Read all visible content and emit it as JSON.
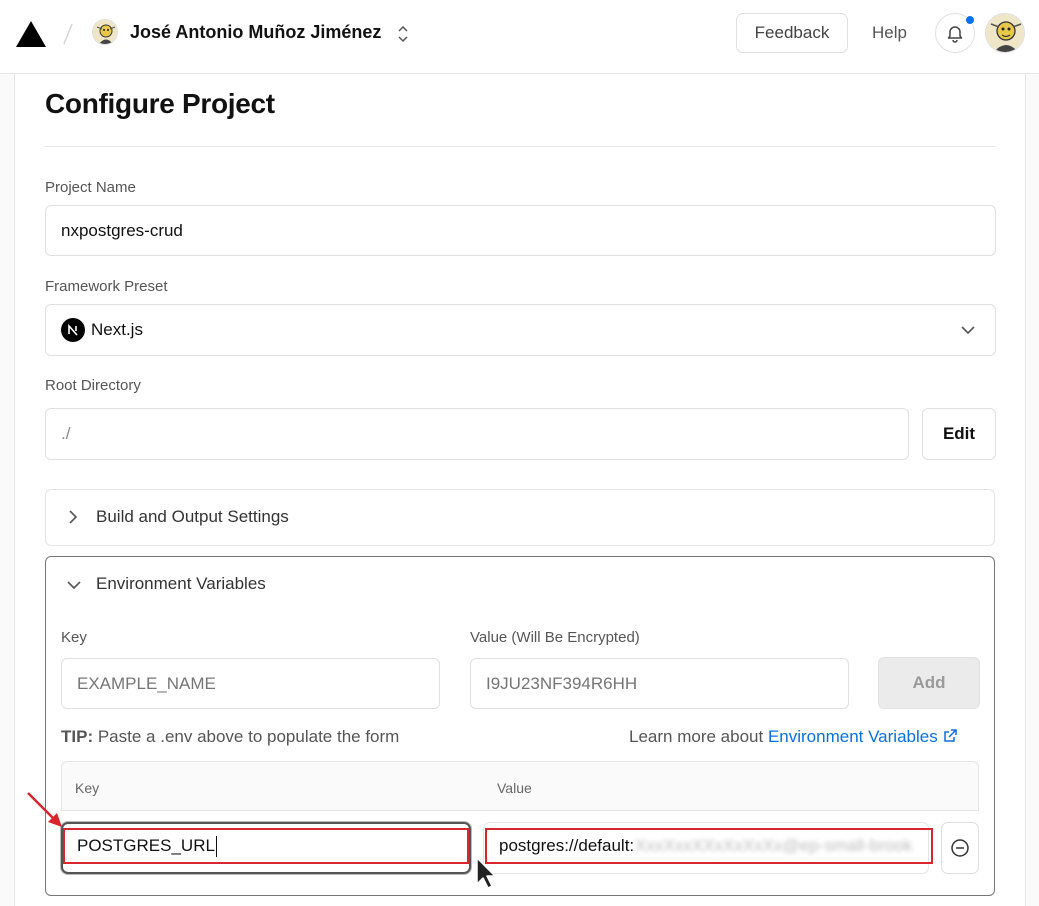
{
  "header": {
    "team_name": "José Antonio Muñoz Jiménez",
    "feedback_label": "Feedback",
    "help_label": "Help",
    "notification_dot_color": "#0a72ef",
    "icons": [
      "logo-triangle-icon",
      "slash-separator-icon",
      "chevron-up-down-icon",
      "bell-icon"
    ]
  },
  "page": {
    "title": "Configure Project"
  },
  "project_name": {
    "label": "Project Name",
    "value": "nxpostgres-crud"
  },
  "framework": {
    "label": "Framework Preset",
    "value": "Next.js",
    "icon": "nextjs-icon"
  },
  "root_directory": {
    "label": "Root Directory",
    "value": "./",
    "edit_label": "Edit"
  },
  "build_settings": {
    "title": "Build and Output Settings",
    "expanded": false
  },
  "env_vars": {
    "title": "Environment Variables",
    "expanded": true,
    "key_label": "Key",
    "value_label": "Value (Will Be Encrypted)",
    "key_placeholder": "EXAMPLE_NAME",
    "value_placeholder": "I9JU23NF394R6HH",
    "add_label": "Add",
    "tip_bold": "TIP:",
    "tip_text": "Paste a .env above to populate the form",
    "learn_prefix": "Learn more about",
    "learn_link": "Environment Variables",
    "table_key_header": "Key",
    "table_value_header": "Value",
    "rows": [
      {
        "key": "POSTGRES_URL",
        "value_visible": "postgres://default:",
        "value_obscured": "XxxXxxXXxXxXxXx@ep-small-brook"
      }
    ]
  },
  "colors": {
    "highlight": "#d7262e",
    "link": "#0a6fdf"
  }
}
